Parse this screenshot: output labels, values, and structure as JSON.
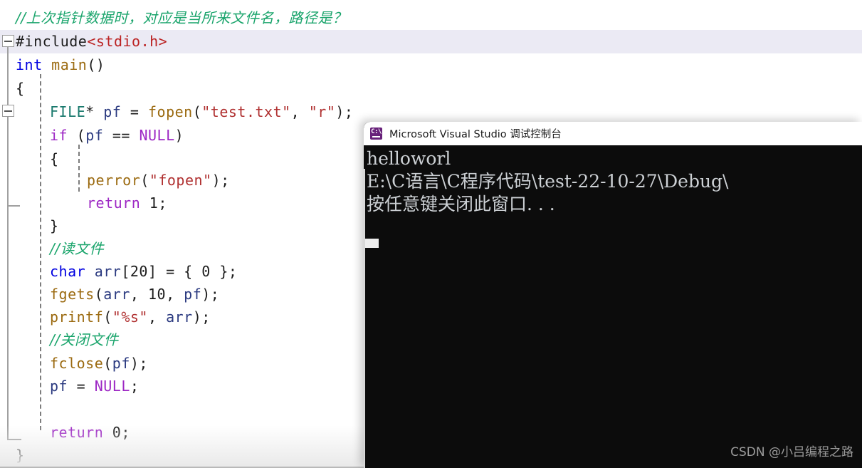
{
  "editor": {
    "name": "visual-studio-code-editor",
    "background": "#ffffff",
    "current_line_highlight_color": "#ebeaf4",
    "lines": [
      {
        "indent": 0,
        "text": "//上次指针数据时，对应是当所来文件名，路径是？",
        "clipped_top": true
      },
      {
        "indent": 0,
        "text": "#include<stdio.h>"
      },
      {
        "indent": 0,
        "text": "int main()"
      },
      {
        "indent": 0,
        "text": "{"
      },
      {
        "indent": 1,
        "text": "FILE* pf = fopen(\"test.txt\", \"r\");"
      },
      {
        "indent": 1,
        "text": "if (pf == NULL)"
      },
      {
        "indent": 1,
        "text": "{"
      },
      {
        "indent": 2,
        "text": "perror(\"fopen\");"
      },
      {
        "indent": 2,
        "text": "return 1;"
      },
      {
        "indent": 1,
        "text": "}"
      },
      {
        "indent": 1,
        "text": "//读文件"
      },
      {
        "indent": 1,
        "text": "char arr[20] = { 0 };"
      },
      {
        "indent": 1,
        "text": "fgets(arr, 10, pf);"
      },
      {
        "indent": 1,
        "text": "printf(\"%s\", arr);"
      },
      {
        "indent": 1,
        "text": "//关闭文件"
      },
      {
        "indent": 1,
        "text": "fclose(pf);"
      },
      {
        "indent": 1,
        "text": "pf = NULL;"
      },
      {
        "indent": 1,
        "text": ""
      },
      {
        "indent": 1,
        "text": "return 0;"
      },
      {
        "indent": 0,
        "text": "}"
      }
    ]
  },
  "console": {
    "title": "Microsoft Visual Studio 调试控制台",
    "icon": "console-app-icon",
    "icon_glyph": "C:\\",
    "background": "#0c0c0c",
    "text_color": "#ccd0d4",
    "lines": [
      "helloworl",
      "E:\\C语言\\C程序代码\\test-22-10-27\\Debug\\",
      "按任意键关闭此窗口. . ."
    ]
  },
  "watermark": {
    "text": "CSDN @小吕编程之路"
  }
}
